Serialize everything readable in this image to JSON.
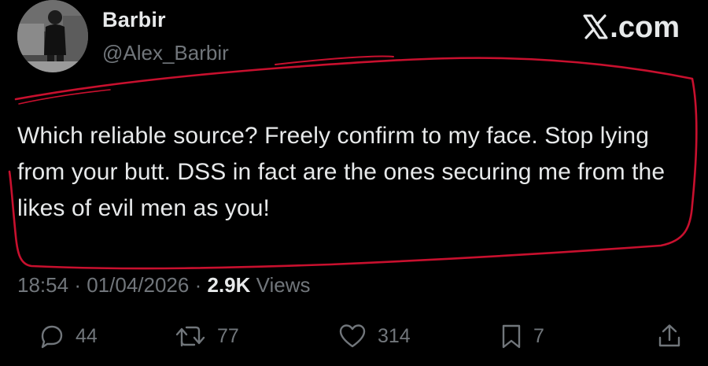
{
  "author": {
    "display_name": "Barbir",
    "handle": "@Alex_Barbir"
  },
  "brand": {
    "label": ".com",
    "icon": "x-logo-icon"
  },
  "tweet": {
    "text": "Which reliable source? Freely confirm to my face. Stop lying from your butt. DSS in fact are the ones securing me from the likes of evil men as you!"
  },
  "meta": {
    "time": "18:54",
    "separator1": "·",
    "date": "01/04/2026",
    "separator2": "·",
    "views_count": "2.9K",
    "views_label": "Views"
  },
  "actions": {
    "replies": {
      "icon": "reply-icon",
      "count": "44"
    },
    "reposts": {
      "icon": "repost-icon",
      "count": "77"
    },
    "likes": {
      "icon": "heart-icon",
      "count": "314"
    },
    "bookmarks": {
      "icon": "bookmark-icon",
      "count": "7"
    },
    "share": {
      "icon": "share-icon"
    }
  },
  "colors": {
    "background": "#000000",
    "text": "#e7e9ea",
    "secondary": "#71767b",
    "annotation": "#c8102e"
  }
}
